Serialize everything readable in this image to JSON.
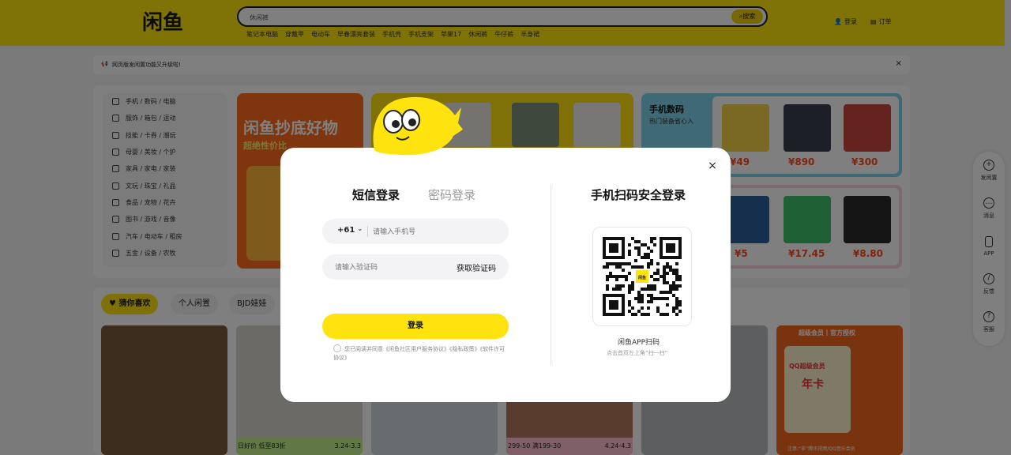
{
  "header": {
    "logo_text": "闲鱼",
    "search": {
      "value": "休闲裤",
      "button": "搜索"
    },
    "hot_words": [
      "笔记本电脑",
      "穿戴甲",
      "电动车",
      "早春漂亮套装",
      "手机壳",
      "手机支架",
      "苹果17",
      "休闲裤",
      "牛仔裤",
      "半身裙"
    ],
    "login": "登录",
    "orders": "订单"
  },
  "notice": {
    "text": "网页版发闲置功能又升级啦!",
    "close": "×"
  },
  "categories": [
    "手机 / 数码 / 电脑",
    "服饰 / 箱包 / 运动",
    "技能 / 卡券 / 潮玩",
    "母婴 / 美妆 / 个护",
    "家具 / 家电 / 家装",
    "文玩 / 珠宝 / 礼品",
    "食品 / 宠物 / 花卉",
    "图书 / 游戏 / 音像",
    "汽车 / 电动车 / 租房",
    "五金 / 设备 / 农牧"
  ],
  "promo1": {
    "title": "闲鱼抄底好物",
    "subtitle": "超绝性价比"
  },
  "promo3": {
    "title": "手机数码",
    "subtitle": "热门装备省心入",
    "prices": [
      "¥49",
      "¥890",
      "¥300"
    ]
  },
  "promo4": {
    "prices": [
      "¥5",
      "¥17.45",
      "¥8.80"
    ]
  },
  "feed": {
    "tabs": [
      "猜你喜欢",
      "个人闲置",
      "BJD娃娃"
    ],
    "card_texts": {
      "c2_tag": "日好价  低至83折",
      "c2_date": "3.24-3.3",
      "c4_tag": "299-50  满199-30",
      "c4_date": "4.24-4.3",
      "c7_top": "超级会员丨官方授权",
      "c7_badge": "QQ超级会员",
      "c7_year": "年卡",
      "c7_foot": "注意:“非”腾讯视频/QQ音乐会员"
    }
  },
  "sidebar": [
    {
      "icon": "plus-icon",
      "label": "发闲置"
    },
    {
      "icon": "message-icon",
      "label": "消息"
    },
    {
      "icon": "phone-icon",
      "label": "APP"
    },
    {
      "icon": "feedback-icon",
      "label": "反馈"
    },
    {
      "icon": "service-icon",
      "label": "客服"
    }
  ],
  "login_modal": {
    "tab_sms": "短信登录",
    "tab_password": "密码登录",
    "country_code": "+61",
    "phone_placeholder": "请输入手机号",
    "code_placeholder": "请输入验证码",
    "get_code": "获取验证码",
    "login_button": "登录",
    "agreement": "您已阅读并同意《闲鱼社区用户服务协议》《隐私政策》《软件许可协议》",
    "qr_title": "手机扫码安全登录",
    "qr_caption": "闲鱼APP扫码",
    "qr_hint": "点击首页左上角“扫一扫”",
    "qr_center": "闲鱼",
    "close": "×"
  },
  "colors": {
    "brand_yellow": "#ffe60f",
    "accent_orange": "#ff4a1a"
  }
}
